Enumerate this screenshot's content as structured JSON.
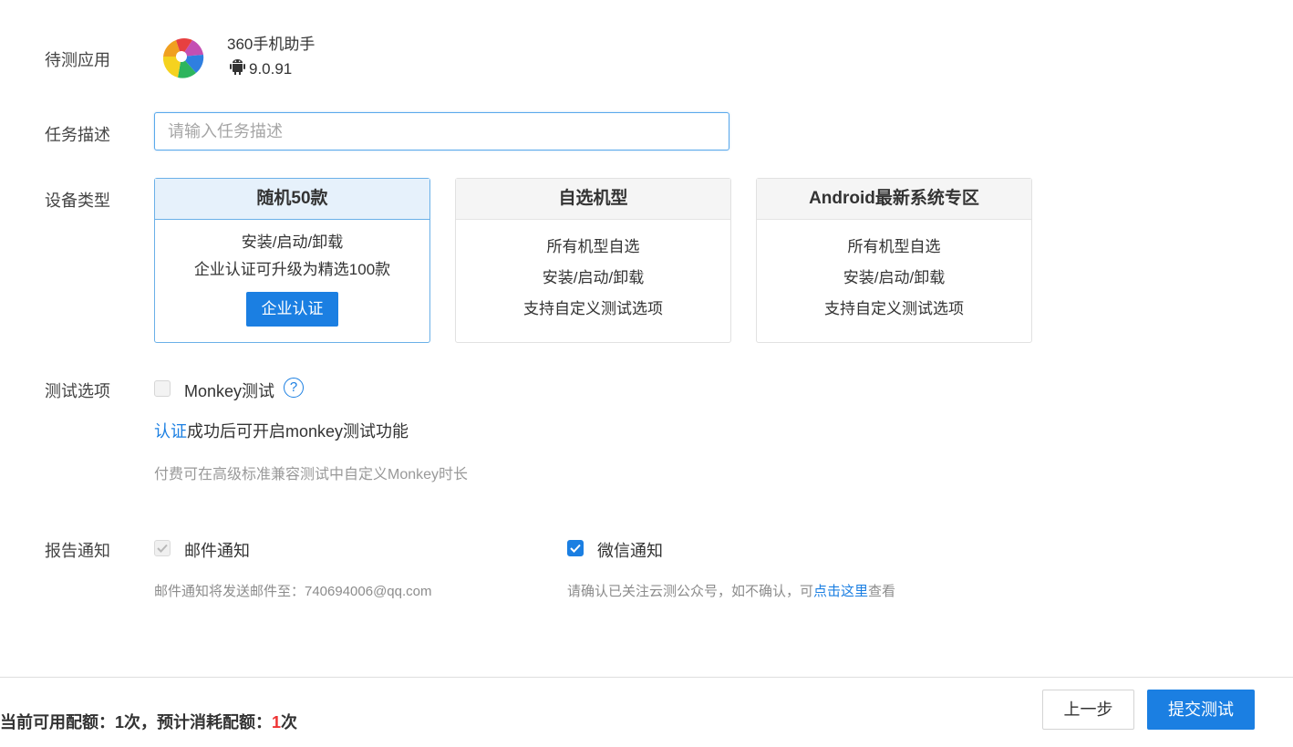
{
  "labels": {
    "app": "待测应用",
    "task": "任务描述",
    "device": "设备类型",
    "test_options": "测试选项",
    "report": "报告通知"
  },
  "app": {
    "name": "360手机助手",
    "version": "9.0.91",
    "icon": "360-assistant-logo",
    "platform_icon": "android-icon"
  },
  "task": {
    "placeholder": "请输入任务描述",
    "value": ""
  },
  "device_cards": [
    {
      "title": "随机50款",
      "selected": true,
      "lines": [
        "安装/启动/卸载",
        "企业认证可升级为精选100款"
      ],
      "button": "企业认证"
    },
    {
      "title": "自选机型",
      "selected": false,
      "lines": [
        "所有机型自选",
        "安装/启动/卸载",
        "支持自定义测试选项"
      ]
    },
    {
      "title": "Android最新系统专区",
      "selected": false,
      "lines": [
        "所有机型自选",
        "安装/启动/卸载",
        "支持自定义测试选项"
      ]
    }
  ],
  "test_options": {
    "monkey_label": "Monkey测试",
    "monkey_checked": false,
    "help_icon": "question-circle-icon",
    "cert_link": "认证",
    "cert_note": "成功后可开启monkey测试功能",
    "paid_note": "付费可在高级标准兼容测试中自定义Monkey时长"
  },
  "report": {
    "email_label": "邮件通知",
    "email_checked": true,
    "email_note": "邮件通知将发送邮件至：740694006@qq.com",
    "wechat_label": "微信通知",
    "wechat_checked": true,
    "wechat_note_prefix": "请确认已关注云测公众号，如不确认，可",
    "wechat_note_link": "点击这里",
    "wechat_note_suffix": "查看"
  },
  "footer": {
    "quota_label": "当前可用配额：",
    "quota_value": "1次",
    "sep": "，",
    "estimate_label": "预计消耗配额：",
    "estimate_value": "1",
    "estimate_unit": "次",
    "prev_button": "上一步",
    "submit_button": "提交测试"
  },
  "colors": {
    "primary": "#1b7fe2",
    "selected_bg": "#e6f1fb",
    "danger": "#e33333"
  }
}
